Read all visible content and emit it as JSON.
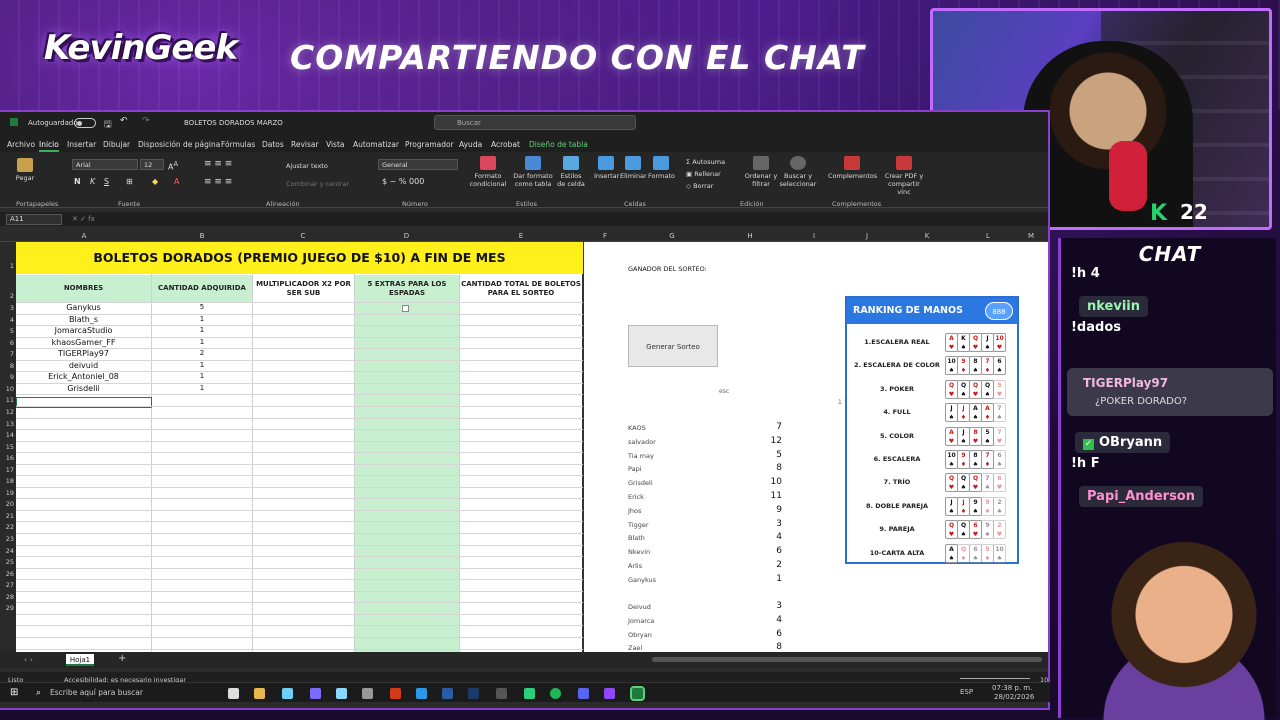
{
  "overlay": {
    "logo_text": "KevinGeek",
    "headline": "COMPARTIENDO CON EL CHAT",
    "viewer_count": "22",
    "chat_title": "CHAT"
  },
  "chat_messages": [
    {
      "text": "!h 4"
    },
    {
      "user": "nkeviin"
    },
    {
      "text": "!dados"
    },
    {
      "user": "TIGERPlay97",
      "text": "¿POKER DORADO?"
    },
    {
      "user": "OBryann"
    },
    {
      "text": "!h F"
    },
    {
      "user": "Papi_Anderson"
    }
  ],
  "excel": {
    "autosave_label": "Autoguardado",
    "doc_title": "BOLETOS DORADOS MARZO",
    "search_placeholder": "Buscar",
    "menu": [
      "Archivo",
      "Inicio",
      "Insertar",
      "Dibujar",
      "Disposición de página",
      "Fórmulas",
      "Datos",
      "Revisar",
      "Vista",
      "Automatizar",
      "Programador",
      "Ayuda",
      "Acrobat",
      "Diseño de tabla"
    ],
    "ribbon": {
      "paste": "Pegar",
      "clipboard": "Portapapeles",
      "font_name": "Arial",
      "font_size": "12",
      "font_group": "Fuente",
      "wrap_text": "Ajustar texto",
      "merge": "Combinar y centrar",
      "alignment_group": "Alineación",
      "number_format": "General",
      "number_group": "Número",
      "cond_format": "Formato condicional",
      "table_format": "Dar formato como tabla",
      "cell_styles": "Estilos de celda",
      "styles_group": "Estilos",
      "insert": "Insertar",
      "delete": "Eliminar",
      "format": "Formato",
      "cells_group": "Celdas",
      "autosum": "Autosuma",
      "fill": "Rellenar",
      "clear": "Borrar",
      "sort": "Ordenar y filtrar",
      "find": "Buscar y seleccionar",
      "editing_group": "Edición",
      "addins": "Complementos",
      "addins_group": "Complementos",
      "pdf": "Crear PDF y compartir vínc"
    },
    "name_box": "A11",
    "columns": [
      "A",
      "B",
      "C",
      "D",
      "E",
      "F",
      "G",
      "H",
      "I",
      "J",
      "K",
      "L",
      "M"
    ],
    "banner": "BOLETOS DORADOS (PREMIO JUEGO DE $10) A FIN DE MES",
    "headers": [
      "NOMBRES",
      "CANTIDAD ADQUIRIDA",
      "MULTIPLICADOR X2 POR SER SUB",
      "5 EXTRAS PARA LOS ESPADAS",
      "CANTIDAD TOTAL DE BOLETOS PARA EL SORTEO"
    ],
    "rows": [
      {
        "name": "Ganykus",
        "qty": "5"
      },
      {
        "name": "Blath_s",
        "qty": "1"
      },
      {
        "name": "JomarcaStudio",
        "qty": "1"
      },
      {
        "name": "khaosGamer_FF",
        "qty": "1"
      },
      {
        "name": "TIGERPlay97",
        "qty": "2"
      },
      {
        "name": "deivuid",
        "qty": "1"
      },
      {
        "name": "Erick_Antoniel_08",
        "qty": "1"
      },
      {
        "name": "Grisdelii",
        "qty": "1"
      }
    ],
    "winner_label": "GANADOR DEL SORTEO:",
    "generate_button": "Generar Sorteo",
    "esc_label": "esc",
    "stray_value": "1",
    "scores": [
      {
        "name": "KAOS",
        "value": "7"
      },
      {
        "name": "salvador",
        "value": "12"
      },
      {
        "name": "Tia may",
        "value": "5"
      },
      {
        "name": "Papi",
        "value": "8"
      },
      {
        "name": "Grisdeli",
        "value": "10"
      },
      {
        "name": "Erick",
        "value": "11"
      },
      {
        "name": "Jhos",
        "value": "9"
      },
      {
        "name": "Tigger",
        "value": "3"
      },
      {
        "name": "Blath",
        "value": "4"
      },
      {
        "name": "Nkevin",
        "value": "6"
      },
      {
        "name": "Arlis",
        "value": "2"
      },
      {
        "name": "Ganykus",
        "value": "1"
      }
    ],
    "scores2": [
      {
        "name": "Deivud",
        "value": "3"
      },
      {
        "name": "Jomarca",
        "value": "4"
      },
      {
        "name": "Obryan",
        "value": "6"
      },
      {
        "name": "Zael",
        "value": "8"
      }
    ],
    "sheet_tab": "Hoja1",
    "status_ready": "Listo",
    "accessibility": "Accesibilidad: es necesario investigar",
    "zoom": "100%"
  },
  "ranking": {
    "title": "RANKING DE MANOS",
    "badge": "888",
    "hands": [
      {
        "name": "1.ESCALERA REAL",
        "cards": [
          "A",
          "K",
          "Q",
          "J",
          "10"
        ]
      },
      {
        "name": "2. ESCALERA DE COLOR",
        "cards": [
          "10",
          "9",
          "8",
          "7",
          "6"
        ]
      },
      {
        "name": "3. POKER",
        "cards": [
          "Q",
          "Q",
          "Q",
          "Q",
          "5"
        ]
      },
      {
        "name": "4. FULL",
        "cards": [
          "J",
          "J",
          "A",
          "A",
          "7"
        ]
      },
      {
        "name": "5. COLOR",
        "cards": [
          "A",
          "J",
          "8",
          "5",
          "7"
        ]
      },
      {
        "name": "6. ESCALERA",
        "cards": [
          "10",
          "9",
          "8",
          "7",
          "6"
        ]
      },
      {
        "name": "7. TRÍO",
        "cards": [
          "Q",
          "Q",
          "Q",
          "7",
          "6"
        ]
      },
      {
        "name": "8. DOBLE PAREJA",
        "cards": [
          "J",
          "J",
          "9",
          "9",
          "2"
        ]
      },
      {
        "name": "9. PAREJA",
        "cards": [
          "Q",
          "Q",
          "6",
          "9",
          "2"
        ]
      },
      {
        "name": "10-CARTA ALTA",
        "cards": [
          "A",
          "Q",
          "6",
          "5",
          "10"
        ]
      }
    ]
  },
  "taskbar": {
    "search_placeholder": "Escribe aquí para buscar",
    "language": "ESP",
    "time": "07:38 p. m.",
    "date": "28/02/2026"
  }
}
